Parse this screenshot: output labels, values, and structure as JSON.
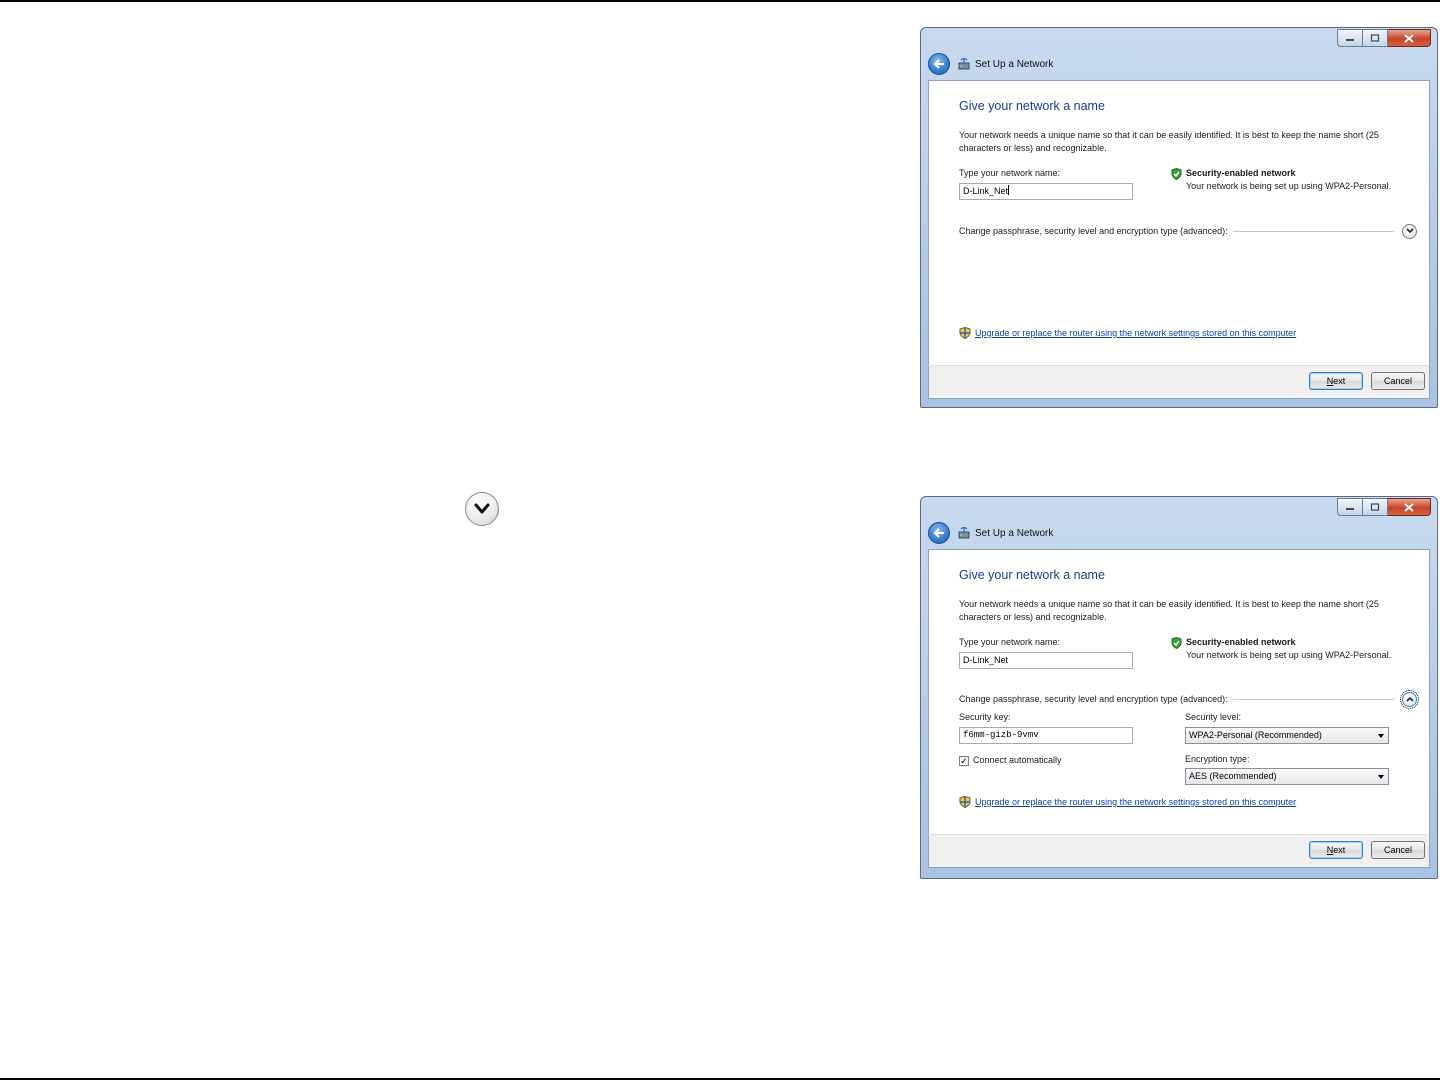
{
  "standalone_icon": "chevron-down-icon",
  "windows": [
    {
      "title": "Set Up a Network",
      "heading": "Give your network a name",
      "description": "Your network needs a unique name so that it can be easily identified. It is best to keep the name short (25 characters or less) and recognizable.",
      "name_label": "Type your network name:",
      "name_value": "D-Link_Net",
      "security_title": "Security-enabled network",
      "security_subtitle": "Your network is being set up using WPA2-Personal.",
      "advanced_label": "Change passphrase, security level and encryption type (advanced):",
      "advanced_expanded": false,
      "link_text": "Upgrade or replace the router using the network settings stored on this computer",
      "next_mnemonic": "N",
      "next_rest": "ext",
      "cancel_label": "Cancel"
    },
    {
      "title": "Set Up a Network",
      "heading": "Give your network a name",
      "description": "Your network needs a unique name so that it can be easily identified. It is best to keep the name short (25 characters or less) and recognizable.",
      "name_label": "Type your network name:",
      "name_value": "D-Link_Net",
      "security_title": "Security-enabled network",
      "security_subtitle": "Your network is being set up using WPA2-Personal.",
      "advanced_label": "Change passphrase, security level and encryption type (advanced):",
      "advanced_expanded": true,
      "security_key_label": "Security key:",
      "security_key_value": "f6mm-gizb-9vmv",
      "security_level_label": "Security level:",
      "security_level_value": "WPA2-Personal (Recommended)",
      "encryption_label": "Encryption type:",
      "encryption_value": "AES (Recommended)",
      "connect_auto_label": "Connect automatically",
      "connect_auto_checked": true,
      "link_text": "Upgrade or replace the router using the network settings stored on this computer",
      "next_mnemonic": "N",
      "next_rest": "ext",
      "cancel_label": "Cancel"
    }
  ]
}
